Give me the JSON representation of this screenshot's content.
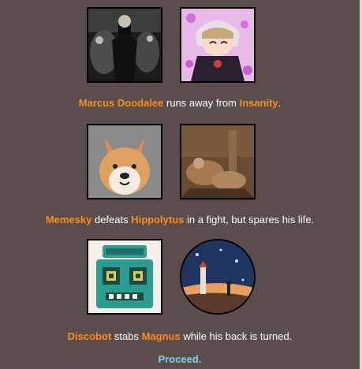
{
  "events": [
    {
      "tribute_a": "Marcus Doodalee",
      "tribute_b": "Insanity",
      "parts": [
        "",
        " runs away from ",
        "."
      ]
    },
    {
      "tribute_a": "Memesky",
      "tribute_b": "Hippolytus",
      "parts": [
        "",
        " defeats ",
        " in a fight, but spares his life."
      ]
    },
    {
      "tribute_a": "Discobot",
      "tribute_b": "Magnus",
      "parts": [
        "",
        " stabs ",
        " while his back is turned."
      ]
    }
  ],
  "proceed_label": "Proceed.",
  "colors": {
    "background": "#5a4d4b",
    "name": "#ff8c1a",
    "link": "#7fd1ea",
    "text": "#ffffff"
  }
}
